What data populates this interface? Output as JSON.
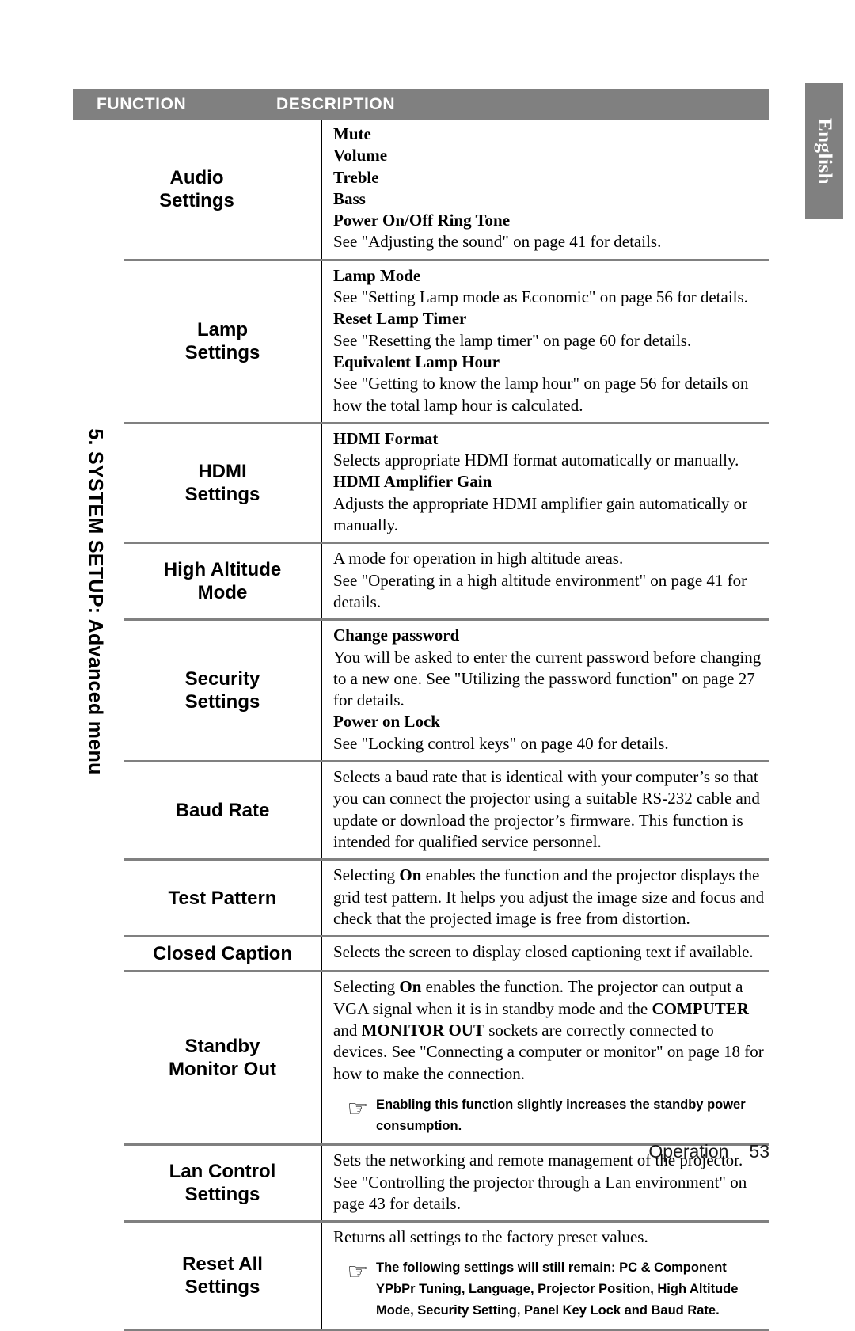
{
  "page": {
    "language_tab": "English",
    "chapter_label": "5. SYSTEM SETUP: Advanced menu",
    "footer_section": "Operation",
    "footer_page_number": "53",
    "link_color": "#3a52a8",
    "header_bg_color": "#808080",
    "rule_color": "#808080"
  },
  "table": {
    "headers": {
      "function": "FUNCTION",
      "description": "DESCRIPTION"
    },
    "rows": [
      {
        "function": "Audio\nSettings",
        "lines": [
          {
            "text": "Mute",
            "style": "bold"
          },
          {
            "text": "Volume",
            "style": "bold"
          },
          {
            "text": "Treble",
            "style": "bold"
          },
          {
            "text": "Bass",
            "style": "bold"
          },
          {
            "text": "Power On/Off Ring Tone",
            "style": "bold"
          },
          {
            "text": "See \"Adjusting the sound\" on page 41 for details.",
            "style": "normal"
          }
        ]
      },
      {
        "function": "Lamp\nSettings",
        "lines": [
          {
            "text": "Lamp Mode",
            "style": "bold"
          },
          {
            "text": "See \"Setting Lamp mode as Economic\" on page 56 for details.",
            "style": "normal"
          },
          {
            "text": "Reset Lamp Timer",
            "style": "bold"
          },
          {
            "text": "See \"Resetting the lamp timer\" on page 60 for details.",
            "style": "normal"
          },
          {
            "text": "Equivalent Lamp Hour",
            "style": "bold"
          },
          {
            "text": "See \"Getting to know the lamp hour\" on page 56 for details on how the total lamp hour is calculated.",
            "style": "normal"
          }
        ]
      },
      {
        "function": "HDMI\nSettings",
        "lines": [
          {
            "text": "HDMI Format",
            "style": "bold"
          },
          {
            "text": "Selects appropriate HDMI format automatically or manually.",
            "style": "normal"
          },
          {
            "text": "HDMI Amplifier Gain",
            "style": "bold"
          },
          {
            "text": "Adjusts the appropriate HDMI amplifier gain automatically or manually.",
            "style": "normal"
          }
        ]
      },
      {
        "function": "High Altitude\nMode",
        "lines": [
          {
            "text": "A mode for operation in high altitude areas.",
            "style": "normal"
          },
          {
            "text": "See \"Operating in a high altitude environment\" on page 41 for details.",
            "style": "normal"
          }
        ]
      },
      {
        "function": "Security\nSettings",
        "lines": [
          {
            "text": "Change password",
            "style": "bold"
          },
          {
            "text": "You will be asked to enter the current password before changing to a new one. See \"Utilizing the password function\" on page 27 for details.",
            "style": "normal"
          },
          {
            "text": "Power on Lock",
            "style": "bold"
          },
          {
            "text": "See \"Locking control keys\" on page 40 for details.",
            "style": "normal"
          }
        ]
      },
      {
        "function": "Baud Rate",
        "lines": [
          {
            "text": "Selects a baud rate that is identical with your computer’s so that you can connect the projector using a suitable RS-232 cable and update or download the projector’s firmware. This function is intended for qualified service personnel.",
            "style": "normal"
          }
        ]
      },
      {
        "function": "Test Pattern",
        "lines": [
          {
            "text": "Selecting On enables the function and the projector displays the grid test pattern. It helps you adjust the image size and focus and check that the projected image is free from distortion.",
            "style": "normal"
          }
        ]
      },
      {
        "function": "Closed Caption",
        "lines": [
          {
            "text": "Selects the screen to display closed captioning text if available.",
            "style": "normal"
          }
        ]
      },
      {
        "function": "Standby\nMonitor Out",
        "lines": [
          {
            "text": "Selecting On enables the function. The projector can output a VGA signal when it is in standby mode and the COMPUTER and MONITOR OUT sockets are correctly connected to devices. See \"Connecting a computer or monitor\" on page 18 for how to make the connection.",
            "style": "normal"
          }
        ],
        "note": {
          "icon": "pointing-hand-icon",
          "glyph": "☞",
          "text": "Enabling this function slightly increases the standby power consumption."
        }
      },
      {
        "function": "Lan Control\nSettings",
        "lines": [
          {
            "text": "Sets the networking and remote management of the projector. See \"Controlling the projector through a Lan environment\" on page 43 for details.",
            "style": "normal"
          }
        ]
      },
      {
        "function": "Reset All\nSettings",
        "lines": [
          {
            "text": "Returns all settings to the factory preset values.",
            "style": "normal"
          }
        ],
        "note": {
          "icon": "pointing-hand-icon",
          "glyph": "☞",
          "text": "The following settings will still remain: PC & Component YPbPr Tuning, Language, Projector Position, High Altitude Mode, Security Setting, Panel Key Lock and Baud Rate."
        }
      }
    ]
  }
}
